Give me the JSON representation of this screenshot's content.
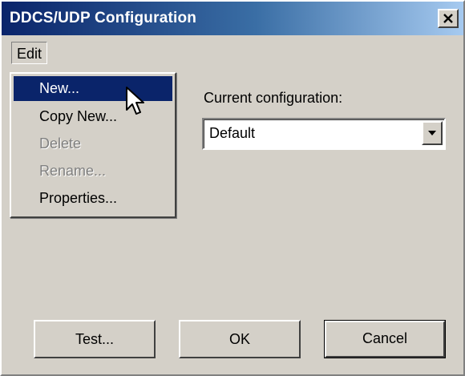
{
  "window": {
    "title": "DDCS/UDP Configuration",
    "close_icon": "close-x-icon"
  },
  "menubar": {
    "edit_label": "Edit"
  },
  "edit_menu": {
    "items": [
      {
        "label": "New...",
        "state": "highlighted"
      },
      {
        "label": "Copy New...",
        "state": "enabled"
      },
      {
        "label": "Delete",
        "state": "disabled"
      },
      {
        "label": "Rename...",
        "state": "disabled"
      },
      {
        "label": "Properties...",
        "state": "enabled"
      }
    ]
  },
  "configuration": {
    "label": "Current configuration:",
    "selected_value": "Default",
    "dropdown_icon": "chevron-down-icon"
  },
  "buttons": {
    "test_label": "Test...",
    "ok_label": "OK",
    "cancel_label": "Cancel"
  },
  "colors": {
    "title_gradient_start": "#0a246a",
    "title_gradient_end": "#a6caf0",
    "face": "#d4d0c8",
    "highlight": "#0a246a",
    "disabled_text": "#808080"
  }
}
